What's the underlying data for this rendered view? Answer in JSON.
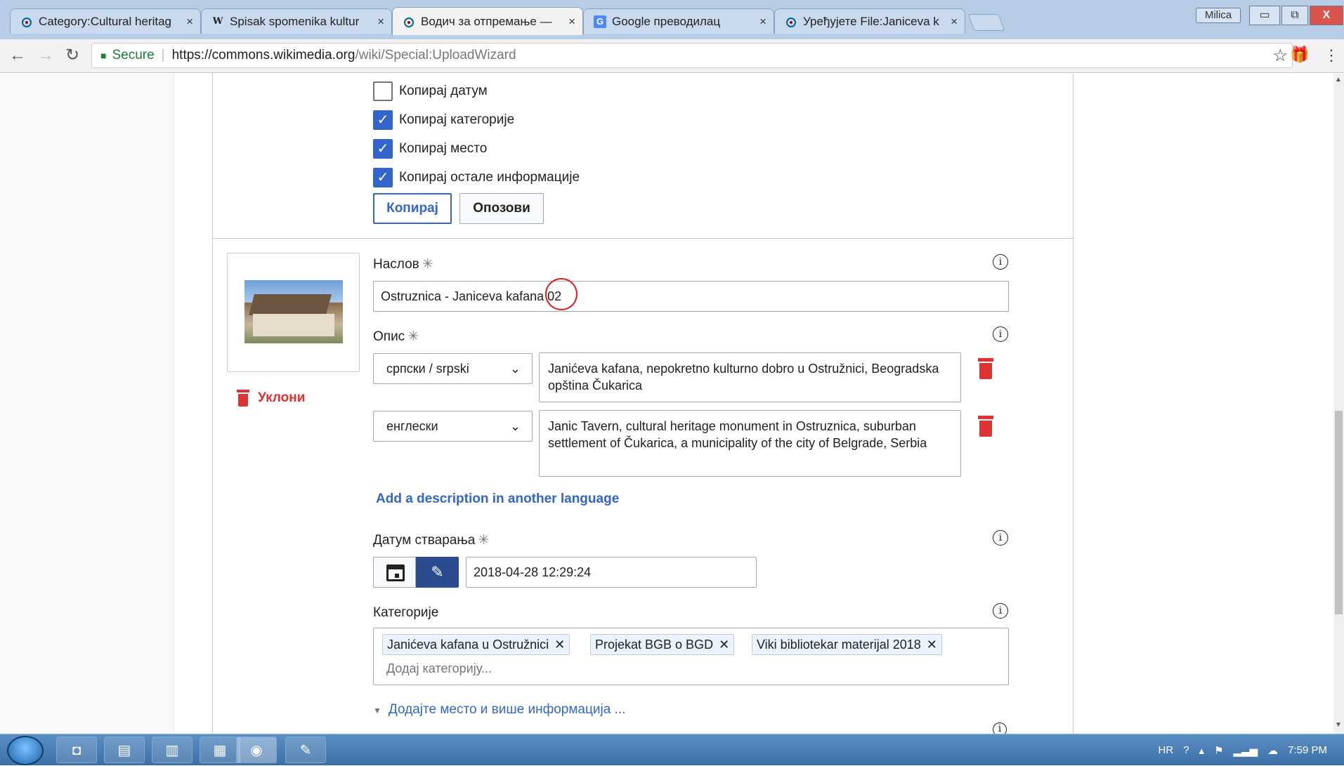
{
  "browser": {
    "tabs": [
      {
        "title": "Category:Cultural heritag",
        "favicon": "commons-icon",
        "active": false
      },
      {
        "title": "Spisak spomenika kultur",
        "favicon": "wikipedia-icon",
        "active": false
      },
      {
        "title": "Водич за отпремање —",
        "favicon": "commons-icon",
        "active": true
      },
      {
        "title": "Google преводилац",
        "favicon": "google-translate-icon",
        "active": false
      },
      {
        "title": "Уређујете File:Janiceva k",
        "favicon": "commons-icon",
        "active": false
      }
    ],
    "close_glyph": "×",
    "profile_name": "Milica",
    "win_min": "▭",
    "win_max": "⧉",
    "win_close": "X",
    "secure_label": "Secure",
    "url_host": "https://commons.wikimedia.org",
    "url_path": "/wiki/Special:UploadWizard"
  },
  "copy_options": {
    "items": [
      {
        "label": "Копирај датум",
        "checked": false
      },
      {
        "label": "Копирај категорије",
        "checked": true
      },
      {
        "label": "Копирај место",
        "checked": true
      },
      {
        "label": "Копирај остале информације",
        "checked": true
      }
    ],
    "copy_button": "Копирај",
    "cancel_button": "Опозови"
  },
  "upload": {
    "remove_label": "Уклони",
    "title_label": "Наслов",
    "title_value": "Ostruznica - Janiceva kafana 02",
    "description_label": "Опис",
    "descriptions": [
      {
        "language": "српски / srpski",
        "text": "Janićeva kafana, nepokretno kulturno dobro u Ostružnici, Beogradska opština Čukarica"
      },
      {
        "language": "енглески",
        "text": "Janic Tavern, cultural heritage monument in Ostruznica, suburban settlement of Čukarica, a municipality of the city of Belgrade, Serbia"
      }
    ],
    "add_description_link": "Add a description in another language",
    "date_label": "Датум стварања",
    "date_value": "2018-04-28 12:29:24",
    "categories_label": "Категорије",
    "categories": [
      "Janićeva kafana u Ostružnici",
      "Projekat BGB o BGD",
      "Viki bibliotekar materijal 2018"
    ],
    "category_placeholder": "Додај категорију...",
    "more_info_link": "Додајте место и више информација ..."
  },
  "taskbar": {
    "lang": "HR",
    "time": "7:59 PM"
  },
  "colors": {
    "accent": "#3366cc",
    "destructive": "#dd3333",
    "annotation_circle": "#e02020"
  }
}
